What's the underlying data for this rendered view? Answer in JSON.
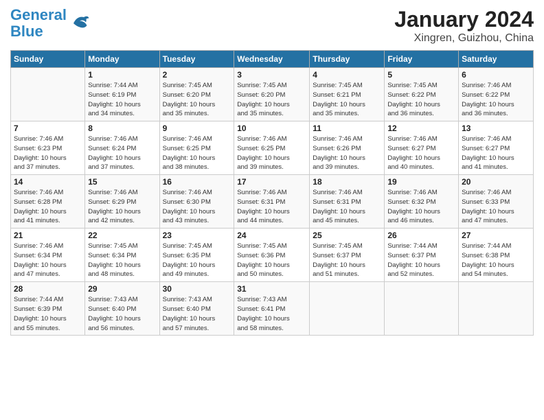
{
  "header": {
    "logo_line1": "General",
    "logo_line2": "Blue",
    "month_year": "January 2024",
    "location": "Xingren, Guizhou, China"
  },
  "days_of_week": [
    "Sunday",
    "Monday",
    "Tuesday",
    "Wednesday",
    "Thursday",
    "Friday",
    "Saturday"
  ],
  "weeks": [
    [
      {
        "day": "",
        "info": ""
      },
      {
        "day": "1",
        "info": "Sunrise: 7:44 AM\nSunset: 6:19 PM\nDaylight: 10 hours\nand 34 minutes."
      },
      {
        "day": "2",
        "info": "Sunrise: 7:45 AM\nSunset: 6:20 PM\nDaylight: 10 hours\nand 35 minutes."
      },
      {
        "day": "3",
        "info": "Sunrise: 7:45 AM\nSunset: 6:20 PM\nDaylight: 10 hours\nand 35 minutes."
      },
      {
        "day": "4",
        "info": "Sunrise: 7:45 AM\nSunset: 6:21 PM\nDaylight: 10 hours\nand 35 minutes."
      },
      {
        "day": "5",
        "info": "Sunrise: 7:45 AM\nSunset: 6:22 PM\nDaylight: 10 hours\nand 36 minutes."
      },
      {
        "day": "6",
        "info": "Sunrise: 7:46 AM\nSunset: 6:22 PM\nDaylight: 10 hours\nand 36 minutes."
      }
    ],
    [
      {
        "day": "7",
        "info": "Sunrise: 7:46 AM\nSunset: 6:23 PM\nDaylight: 10 hours\nand 37 minutes."
      },
      {
        "day": "8",
        "info": "Sunrise: 7:46 AM\nSunset: 6:24 PM\nDaylight: 10 hours\nand 37 minutes."
      },
      {
        "day": "9",
        "info": "Sunrise: 7:46 AM\nSunset: 6:25 PM\nDaylight: 10 hours\nand 38 minutes."
      },
      {
        "day": "10",
        "info": "Sunrise: 7:46 AM\nSunset: 6:25 PM\nDaylight: 10 hours\nand 39 minutes."
      },
      {
        "day": "11",
        "info": "Sunrise: 7:46 AM\nSunset: 6:26 PM\nDaylight: 10 hours\nand 39 minutes."
      },
      {
        "day": "12",
        "info": "Sunrise: 7:46 AM\nSunset: 6:27 PM\nDaylight: 10 hours\nand 40 minutes."
      },
      {
        "day": "13",
        "info": "Sunrise: 7:46 AM\nSunset: 6:27 PM\nDaylight: 10 hours\nand 41 minutes."
      }
    ],
    [
      {
        "day": "14",
        "info": "Sunrise: 7:46 AM\nSunset: 6:28 PM\nDaylight: 10 hours\nand 41 minutes."
      },
      {
        "day": "15",
        "info": "Sunrise: 7:46 AM\nSunset: 6:29 PM\nDaylight: 10 hours\nand 42 minutes."
      },
      {
        "day": "16",
        "info": "Sunrise: 7:46 AM\nSunset: 6:30 PM\nDaylight: 10 hours\nand 43 minutes."
      },
      {
        "day": "17",
        "info": "Sunrise: 7:46 AM\nSunset: 6:31 PM\nDaylight: 10 hours\nand 44 minutes."
      },
      {
        "day": "18",
        "info": "Sunrise: 7:46 AM\nSunset: 6:31 PM\nDaylight: 10 hours\nand 45 minutes."
      },
      {
        "day": "19",
        "info": "Sunrise: 7:46 AM\nSunset: 6:32 PM\nDaylight: 10 hours\nand 46 minutes."
      },
      {
        "day": "20",
        "info": "Sunrise: 7:46 AM\nSunset: 6:33 PM\nDaylight: 10 hours\nand 47 minutes."
      }
    ],
    [
      {
        "day": "21",
        "info": "Sunrise: 7:46 AM\nSunset: 6:34 PM\nDaylight: 10 hours\nand 47 minutes."
      },
      {
        "day": "22",
        "info": "Sunrise: 7:45 AM\nSunset: 6:34 PM\nDaylight: 10 hours\nand 48 minutes."
      },
      {
        "day": "23",
        "info": "Sunrise: 7:45 AM\nSunset: 6:35 PM\nDaylight: 10 hours\nand 49 minutes."
      },
      {
        "day": "24",
        "info": "Sunrise: 7:45 AM\nSunset: 6:36 PM\nDaylight: 10 hours\nand 50 minutes."
      },
      {
        "day": "25",
        "info": "Sunrise: 7:45 AM\nSunset: 6:37 PM\nDaylight: 10 hours\nand 51 minutes."
      },
      {
        "day": "26",
        "info": "Sunrise: 7:44 AM\nSunset: 6:37 PM\nDaylight: 10 hours\nand 52 minutes."
      },
      {
        "day": "27",
        "info": "Sunrise: 7:44 AM\nSunset: 6:38 PM\nDaylight: 10 hours\nand 54 minutes."
      }
    ],
    [
      {
        "day": "28",
        "info": "Sunrise: 7:44 AM\nSunset: 6:39 PM\nDaylight: 10 hours\nand 55 minutes."
      },
      {
        "day": "29",
        "info": "Sunrise: 7:43 AM\nSunset: 6:40 PM\nDaylight: 10 hours\nand 56 minutes."
      },
      {
        "day": "30",
        "info": "Sunrise: 7:43 AM\nSunset: 6:40 PM\nDaylight: 10 hours\nand 57 minutes."
      },
      {
        "day": "31",
        "info": "Sunrise: 7:43 AM\nSunset: 6:41 PM\nDaylight: 10 hours\nand 58 minutes."
      },
      {
        "day": "",
        "info": ""
      },
      {
        "day": "",
        "info": ""
      },
      {
        "day": "",
        "info": ""
      }
    ]
  ]
}
